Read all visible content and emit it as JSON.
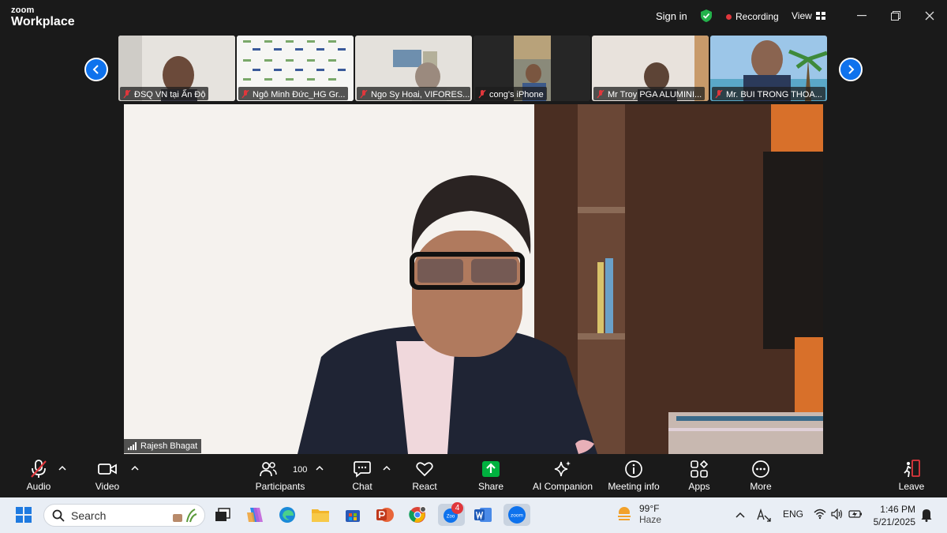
{
  "titlebar": {
    "brand_top": "zoom",
    "brand_bottom": "Workplace",
    "sign_in": "Sign in",
    "recording": "Recording",
    "view": "View"
  },
  "participants_strip": [
    {
      "name": "ĐSQ VN tại Ấn Độ"
    },
    {
      "name": "Ngô Minh Đức_HG Gr..."
    },
    {
      "name": "Ngo Sy Hoai, VIFORES..."
    },
    {
      "name": "cong's iPhone"
    },
    {
      "name": "Mr Troy PGA ALUMINI..."
    },
    {
      "name": "Mr. BUI TRONG THOA..."
    }
  ],
  "main_speaker": {
    "name": "Rajesh Bhagat"
  },
  "toolbar": {
    "audio": "Audio",
    "video": "Video",
    "participants": "Participants",
    "participants_count": "100",
    "chat": "Chat",
    "react": "React",
    "share": "Share",
    "ai_companion": "AI Companion",
    "meeting_info": "Meeting info",
    "apps": "Apps",
    "more": "More",
    "leave": "Leave"
  },
  "taskbar": {
    "search_placeholder": "Search",
    "zoom_badge": "4",
    "zoom_app_label": "zoom",
    "weather_temp": "99°F",
    "weather_desc": "Haze",
    "language": "ENG",
    "time": "1:46 PM",
    "date": "5/21/2025"
  },
  "colors": {
    "accent_blue": "#0e72ed",
    "share_green": "#00b13f",
    "recording_red": "#e0373c",
    "leave_red": "#e0373c"
  }
}
